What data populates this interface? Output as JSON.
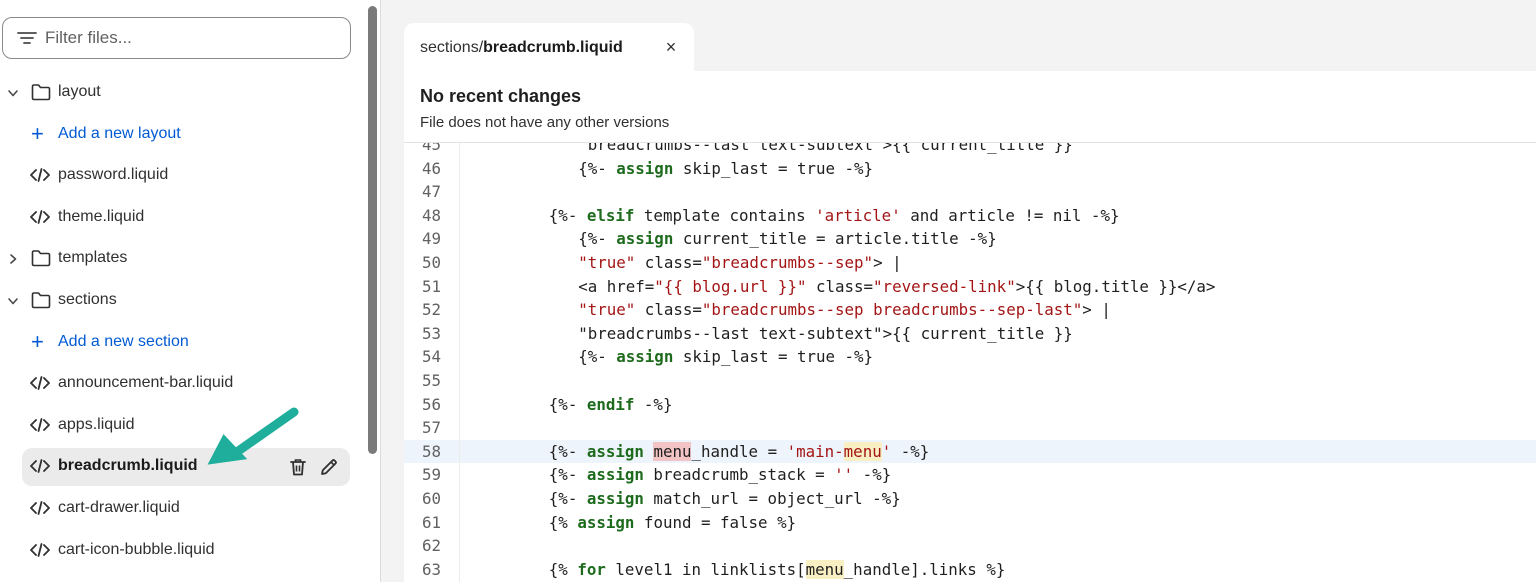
{
  "sidebar": {
    "filter_placeholder": "Filter files...",
    "tree": [
      {
        "kind": "folder",
        "label": "layout",
        "expanded": true
      },
      {
        "kind": "add",
        "label": "Add a new layout"
      },
      {
        "kind": "file",
        "label": "password.liquid"
      },
      {
        "kind": "file",
        "label": "theme.liquid"
      },
      {
        "kind": "folder",
        "label": "templates",
        "expanded": false
      },
      {
        "kind": "folder",
        "label": "sections",
        "expanded": true
      },
      {
        "kind": "add",
        "label": "Add a new section"
      },
      {
        "kind": "file",
        "label": "announcement-bar.liquid"
      },
      {
        "kind": "file",
        "label": "apps.liquid"
      },
      {
        "kind": "file",
        "label": "breadcrumb.liquid",
        "active": true
      },
      {
        "kind": "file",
        "label": "cart-drawer.liquid"
      },
      {
        "kind": "file",
        "label": "cart-icon-bubble.liquid"
      }
    ],
    "active_actions": [
      "trash-icon",
      "pencil-icon"
    ]
  },
  "editor": {
    "tab": {
      "prefix": "sections/",
      "name": "breadcrumb.liquid",
      "close": "×"
    },
    "notice": {
      "title": "No recent changes",
      "subtitle": "File does not have any other versions"
    },
    "highlighted_line": "58",
    "lines": [
      {
        "n": "45",
        "html": "  <span class=<span class=\"str\">\"breadcrumbs--last text-subtext\"</span>>{{ current_title }}</span>"
      },
      {
        "n": "46",
        "html": "  {%- <span class=\"kw\">assign</span> skip_last = true -%}"
      },
      {
        "n": "47",
        "html": ""
      },
      {
        "n": "48",
        "html": "{%- <span class=\"kw\">elsif</span> template contains <span class=\"str\">'article'</span> and article != nil -%}"
      },
      {
        "n": "49",
        "html": "  {%- <span class=\"kw\">assign</span> current_title = article.title -%}"
      },
      {
        "n": "50",
        "html": "  <span aria-hidden=<span class=\"str\">\"true\"</span> class=<span class=\"str\">\"breadcrumbs--sep\"</span>> | </span>"
      },
      {
        "n": "51",
        "html": "  <a href=<span class=\"str\">\"{{ blog.url }}\"</span> class=<span class=\"str\">\"reversed-link\"</span>>{{ blog.title }}</a>"
      },
      {
        "n": "52",
        "html": "  <span aria-hidden=<span class=\"str\">\"true\"</span> class=<span class=\"str\">\"breadcrumbs--sep breadcrumbs--sep-last\"</span>> | </span>"
      },
      {
        "n": "53",
        "html": "  <span class=<span class=\"str\">\"breadcrumbs--last text-subtext\"</span>>{{ current_title }}</span>"
      },
      {
        "n": "54",
        "html": "  {%- <span class=\"kw\">assign</span> skip_last = true -%}"
      },
      {
        "n": "55",
        "html": ""
      },
      {
        "n": "56",
        "html": "{%- <span class=\"kw\">endif</span> -%}"
      },
      {
        "n": "57",
        "html": ""
      },
      {
        "n": "58",
        "html": "{%- <span class=\"kw\">assign</span> <span class=\"sel-a\">menu</span>_handle = <span class=\"str\">'main-<span class=\"sel-b\">menu</span>'</span> -%}"
      },
      {
        "n": "59",
        "html": "{%- <span class=\"kw\">assign</span> breadcrumb_stack = <span class=\"str\">''</span> -%}"
      },
      {
        "n": "60",
        "html": "{%- <span class=\"kw\">assign</span> match_url = object_url -%}"
      },
      {
        "n": "61",
        "html": "{% <span class=\"kw\">assign</span> found = false %}"
      },
      {
        "n": "62",
        "html": ""
      },
      {
        "n": "63",
        "html": "{% <span class=\"kw\">for</span> level1 in linklists[<span class=\"sel-b\">menu</span>_handle].links %}"
      }
    ]
  },
  "colors": {
    "accent_link": "#005bd3",
    "keyword": "#1e6b1e",
    "string": "#a31515",
    "annotation_arrow": "#1fae9b"
  }
}
